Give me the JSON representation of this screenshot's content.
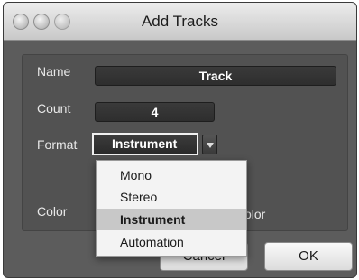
{
  "window": {
    "title": "Add Tracks"
  },
  "form": {
    "name_label": "Name",
    "name_value": "Track",
    "count_label": "Count",
    "count_value": "4",
    "format_label": "Format",
    "format_value": "Instrument",
    "color_label": "Color",
    "color_label_right": "olor"
  },
  "format_menu": {
    "items": [
      "Mono",
      "Stereo",
      "Instrument",
      "Automation"
    ],
    "selected": "Instrument"
  },
  "buttons": {
    "cancel": "Cancel",
    "ok": "OK"
  }
}
